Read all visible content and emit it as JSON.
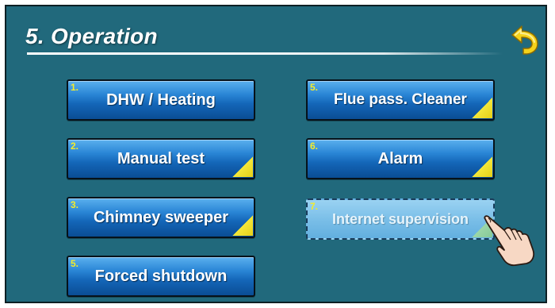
{
  "header": {
    "title": "5. Operation"
  },
  "back_button": {
    "icon": "back-arrow-icon",
    "color": "#f5d21a"
  },
  "menu": {
    "items": [
      {
        "number": "1.",
        "label": "DHW / Heating",
        "has_submenu": false,
        "enabled": true
      },
      {
        "number": "2.",
        "label": "Manual test",
        "has_submenu": true,
        "enabled": true
      },
      {
        "number": "3.",
        "label": "Chimney sweeper",
        "has_submenu": true,
        "enabled": true
      },
      {
        "number": "5.",
        "label": "Forced shutdown",
        "has_submenu": false,
        "enabled": true
      },
      {
        "number": "5.",
        "label": "Flue pass. Cleaner",
        "has_submenu": true,
        "enabled": true
      },
      {
        "number": "6.",
        "label": "Alarm",
        "has_submenu": true,
        "enabled": true
      },
      {
        "number": "7.",
        "label": "Internet supervision",
        "has_submenu": true,
        "enabled": false
      }
    ]
  },
  "colors": {
    "background": "#21697c",
    "button": "#1466b8",
    "button_disabled": "#7bbfe8",
    "number": "#f4ec2a",
    "submenu_corner": "#f4e83a"
  },
  "pointer": {
    "icon": "pointing-hand-icon"
  }
}
